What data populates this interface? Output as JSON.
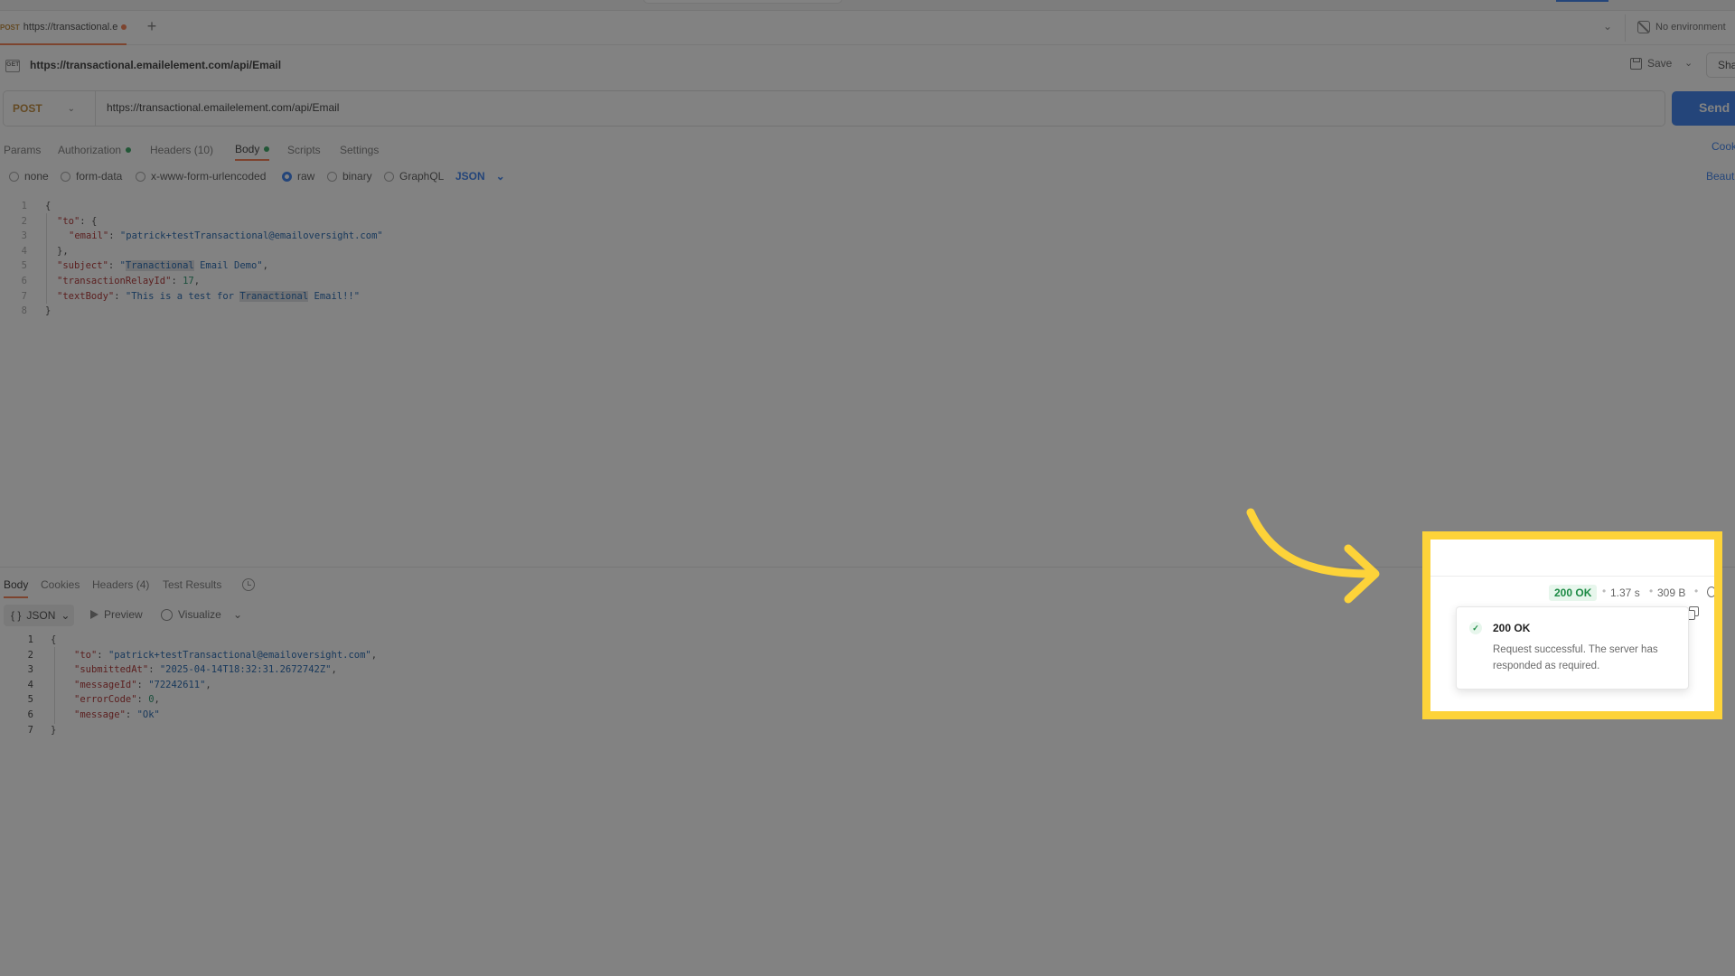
{
  "tabbar": {
    "tab_method": "POST",
    "tab_title": "https://transactional.emailelement.com/api/Email",
    "new_tab": "+",
    "environment": "No environment"
  },
  "header": {
    "breadcrumb": "https://transactional.emailelement.com/api/Email",
    "save_label": "Save",
    "share_label": "Share"
  },
  "request": {
    "method": "POST",
    "url": "https://transactional.emailelement.com/api/Email",
    "send_label": "Send"
  },
  "request_tabs": [
    {
      "label": "Params"
    },
    {
      "label": "Authorization",
      "dot": true
    },
    {
      "label": "Headers (10)"
    },
    {
      "label": "Body",
      "dot": true,
      "active": true
    },
    {
      "label": "Scripts"
    },
    {
      "label": "Settings"
    }
  ],
  "cookies_label": "Cookies",
  "body_types": {
    "options": [
      "none",
      "form-data",
      "x-www-form-urlencoded",
      "raw",
      "binary",
      "GraphQL"
    ],
    "selected": "raw",
    "language": "JSON",
    "beautify_label": "Beautify"
  },
  "request_body": {
    "line_numbers": [
      "1",
      "2",
      "3",
      "4",
      "5",
      "6",
      "7",
      "8"
    ],
    "l1": "{",
    "to_key": "\"to\"",
    "to_open": ": {",
    "email_key": "\"email\"",
    "email_val": "\"patrick+testTransactional@emailoversight.com\"",
    "to_close": "},",
    "subject_key": "\"subject\"",
    "subject_q": "\"",
    "subject_hl": "Tranactional",
    "subject_rest": " Email Demo\"",
    "relay_key": "\"transactionRelayId\"",
    "relay_val": "17",
    "text_key": "\"textBody\"",
    "text_pre": "\"This is a test for ",
    "text_hl": "Tranactional",
    "text_rest": " Email!!\"",
    "l8": "}"
  },
  "response_tabs": [
    {
      "label": "Body",
      "active": true
    },
    {
      "label": "Cookies"
    },
    {
      "label": "Headers (4)"
    },
    {
      "label": "Test Results"
    }
  ],
  "response_tools": {
    "format": "JSON",
    "format_icon": "{ }",
    "preview": "Preview",
    "visualize": "Visualize"
  },
  "response_body": {
    "line_numbers": [
      "1",
      "2",
      "3",
      "4",
      "5",
      "6",
      "7"
    ],
    "l1": "{",
    "to_key": "\"to\"",
    "to_val": "\"patrick+testTransactional@emailoversight.com\"",
    "submitted_key": "\"submittedAt\"",
    "submitted_val": "\"2025-04-14T18:32:31.2672742Z\"",
    "msgid_key": "\"messageId\"",
    "msgid_val": "\"72242611\"",
    "err_key": "\"errorCode\"",
    "err_val": "0",
    "msg_key": "\"message\"",
    "msg_val": "\"Ok\"",
    "l7": "}"
  },
  "response_status": {
    "status": "200 OK",
    "time": "1.37 s",
    "size": "309 B",
    "tooltip_title": "200 OK",
    "tooltip_desc": "Request successful. The server has responded as required."
  },
  "colors": {
    "accent": "#1f6feb",
    "method": "#b7791f",
    "active_tab": "#f26b3a",
    "success": "#1c8a44",
    "highlight_frame": "#fdd339"
  }
}
